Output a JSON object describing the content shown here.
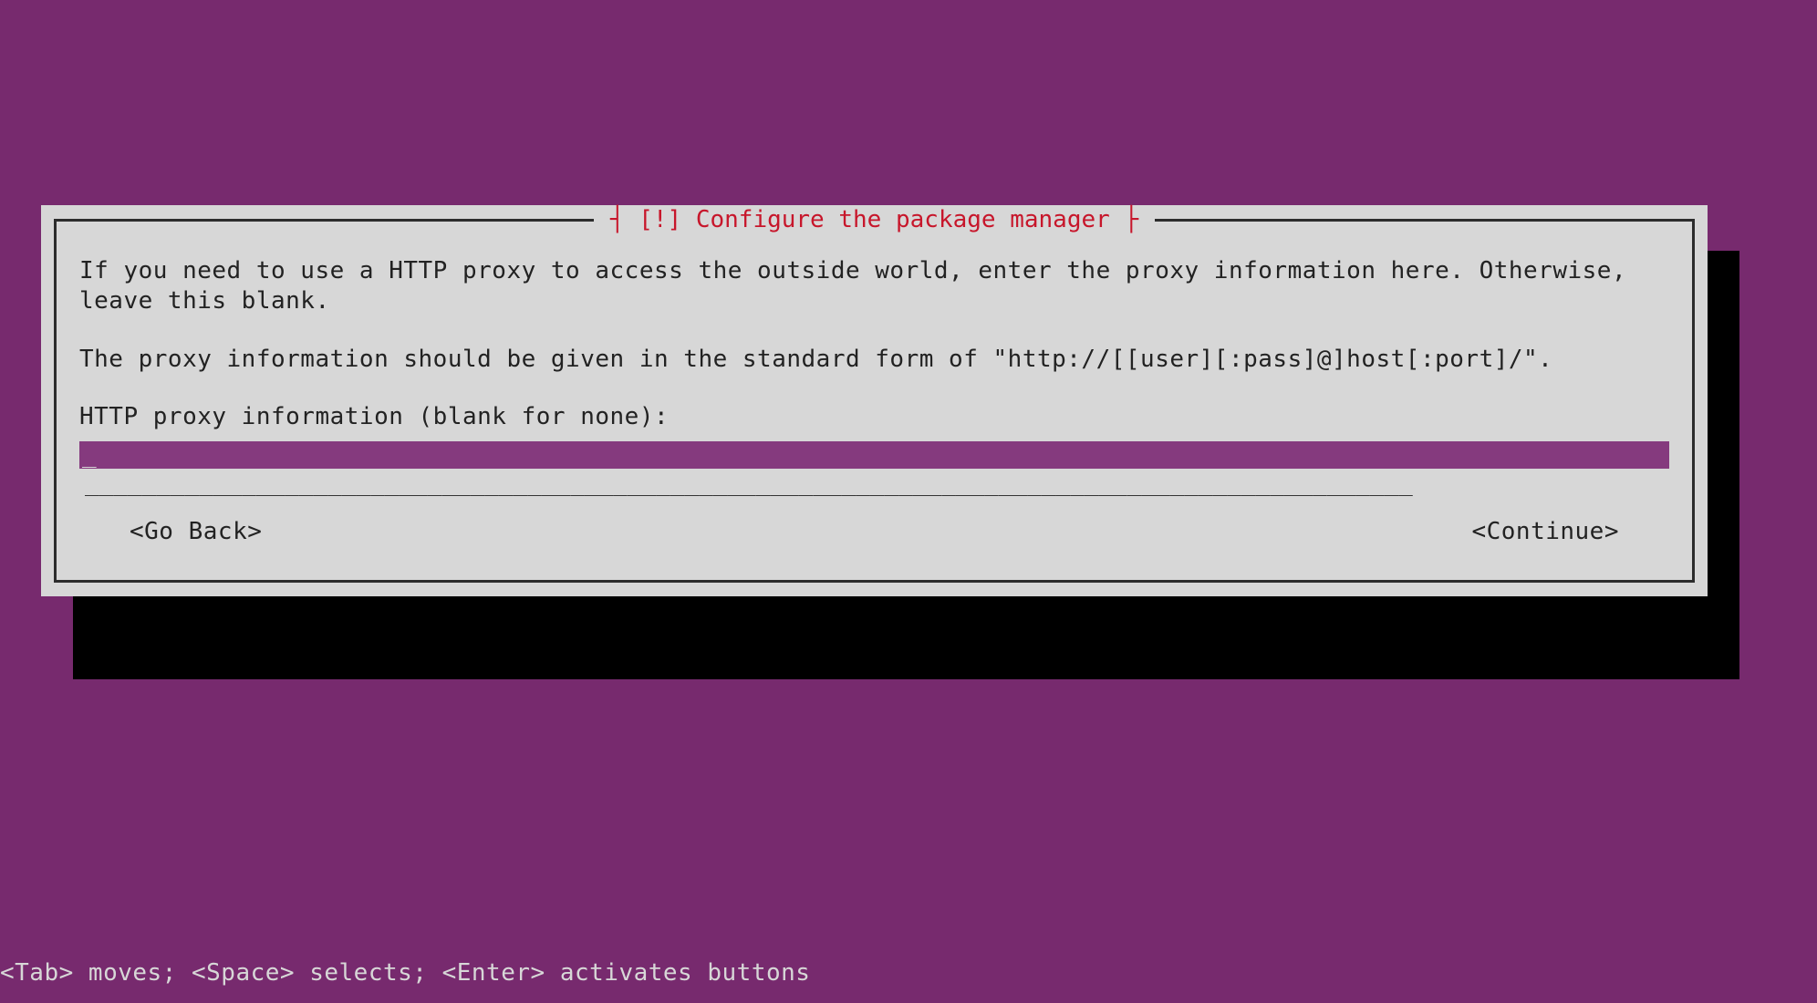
{
  "dialog": {
    "title": "[!] Configure the package manager",
    "paragraph1": "If you need to use a HTTP proxy to access the outside world, enter the proxy information here. Otherwise, leave this blank.",
    "paragraph2": "The proxy information should be given in the standard form of \"http://[[user][:pass]@]host[:port]/\".",
    "prompt": "HTTP proxy information (blank for none):",
    "input_value": "",
    "underline": "_____________________________________________________________________________________________",
    "buttons": {
      "back": "<Go Back>",
      "continue": "<Continue>"
    }
  },
  "footer_hint": "<Tab> moves; <Space> selects; <Enter> activates buttons"
}
